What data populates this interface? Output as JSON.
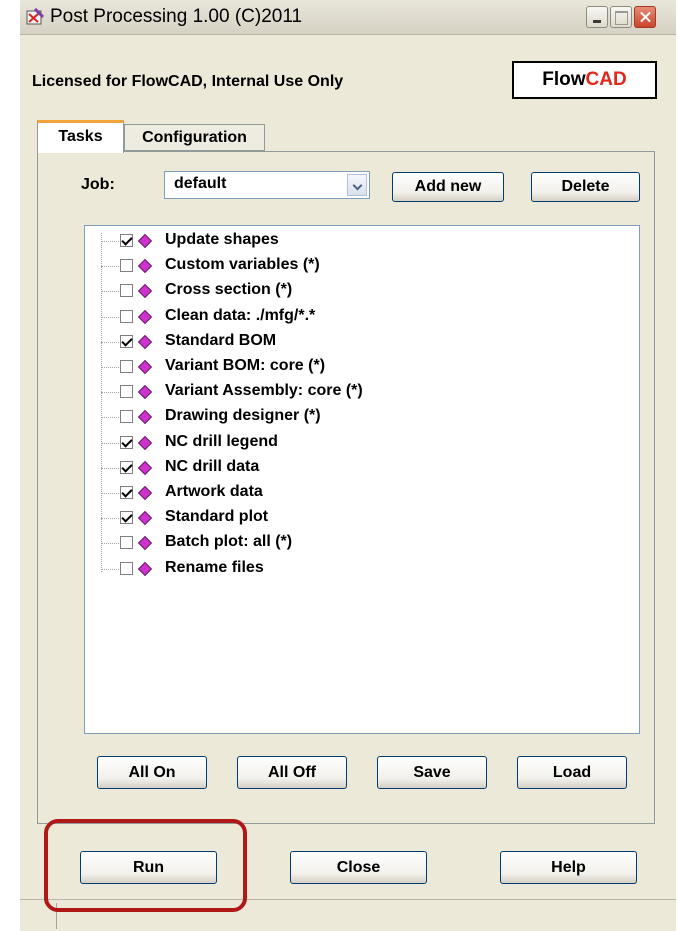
{
  "window": {
    "title": "Post Processing 1.00 (C)2011"
  },
  "license_text": "Licensed for FlowCAD, Internal Use Only",
  "logo": {
    "part1": "Flow",
    "part2": "CAD",
    "color_part2": "#e0281c"
  },
  "tabs": [
    {
      "label": "Tasks",
      "active": true
    },
    {
      "label": "Configuration",
      "active": false
    }
  ],
  "job": {
    "label": "Job:",
    "selected": "default",
    "add_label": "Add new",
    "delete_label": "Delete"
  },
  "tasks": [
    {
      "label": "Update shapes",
      "checked": true
    },
    {
      "label": "Custom variables (*)",
      "checked": false
    },
    {
      "label": "Cross section (*)",
      "checked": false
    },
    {
      "label": "Clean data: ./mfg/*.*",
      "checked": false
    },
    {
      "label": "Standard BOM",
      "checked": true
    },
    {
      "label": "Variant BOM: core (*)",
      "checked": false
    },
    {
      "label": "Variant Assembly: core (*)",
      "checked": false
    },
    {
      "label": "Drawing designer (*)",
      "checked": false
    },
    {
      "label": "NC drill legend",
      "checked": true
    },
    {
      "label": "NC drill data",
      "checked": true
    },
    {
      "label": "Artwork data",
      "checked": true
    },
    {
      "label": "Standard plot",
      "checked": true
    },
    {
      "label": "Batch plot: all (*)",
      "checked": false
    },
    {
      "label": "Rename files",
      "checked": false
    }
  ],
  "list_buttons": {
    "all_on": "All On",
    "all_off": "All Off",
    "save": "Save",
    "load": "Load"
  },
  "bottom_buttons": {
    "run": "Run",
    "close": "Close",
    "help": "Help"
  },
  "colors": {
    "highlight": "#b01818",
    "task_bullet": "#cc33cc"
  }
}
